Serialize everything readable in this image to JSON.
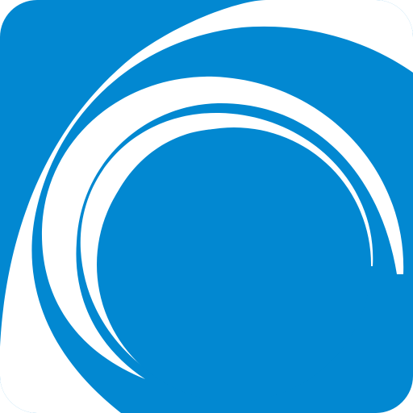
{
  "icon": {
    "name": "swirl-logo-icon",
    "colors": {
      "brand_blue": "#0288D1",
      "swirl_white": "#FFFFFF"
    }
  }
}
